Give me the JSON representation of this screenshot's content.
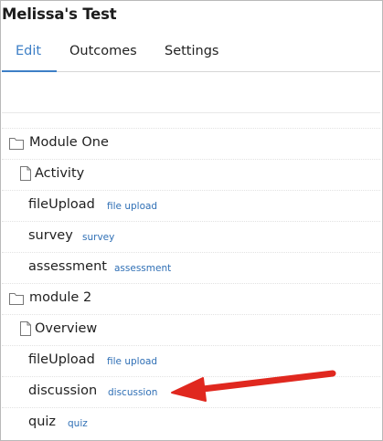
{
  "header": {
    "title": "Melissa's Test"
  },
  "tabs": [
    {
      "label": "Edit",
      "active": true
    },
    {
      "label": "Outcomes",
      "active": false
    },
    {
      "label": "Settings",
      "active": false
    }
  ],
  "tree": {
    "modules": [
      {
        "name": "Module One",
        "icon": "folder-icon",
        "page": {
          "name": "Activity",
          "icon": "page-icon"
        },
        "items": [
          {
            "name": "fileUpload",
            "type": "file upload"
          },
          {
            "name": "survey",
            "type": "survey"
          },
          {
            "name": "assessment",
            "type": "assessment"
          }
        ]
      },
      {
        "name": "module 2",
        "icon": "folder-icon",
        "page": {
          "name": "Overview",
          "icon": "page-icon"
        },
        "items": [
          {
            "name": "fileUpload",
            "type": "file upload"
          },
          {
            "name": "discussion",
            "type": "discussion"
          },
          {
            "name": "quiz",
            "type": "quiz"
          }
        ]
      }
    ]
  },
  "annotation": {
    "icon": "red-arrow-icon",
    "color": "#e0281f"
  },
  "colors": {
    "accent": "#3d7fc6",
    "tag": "#2f6fb5"
  }
}
